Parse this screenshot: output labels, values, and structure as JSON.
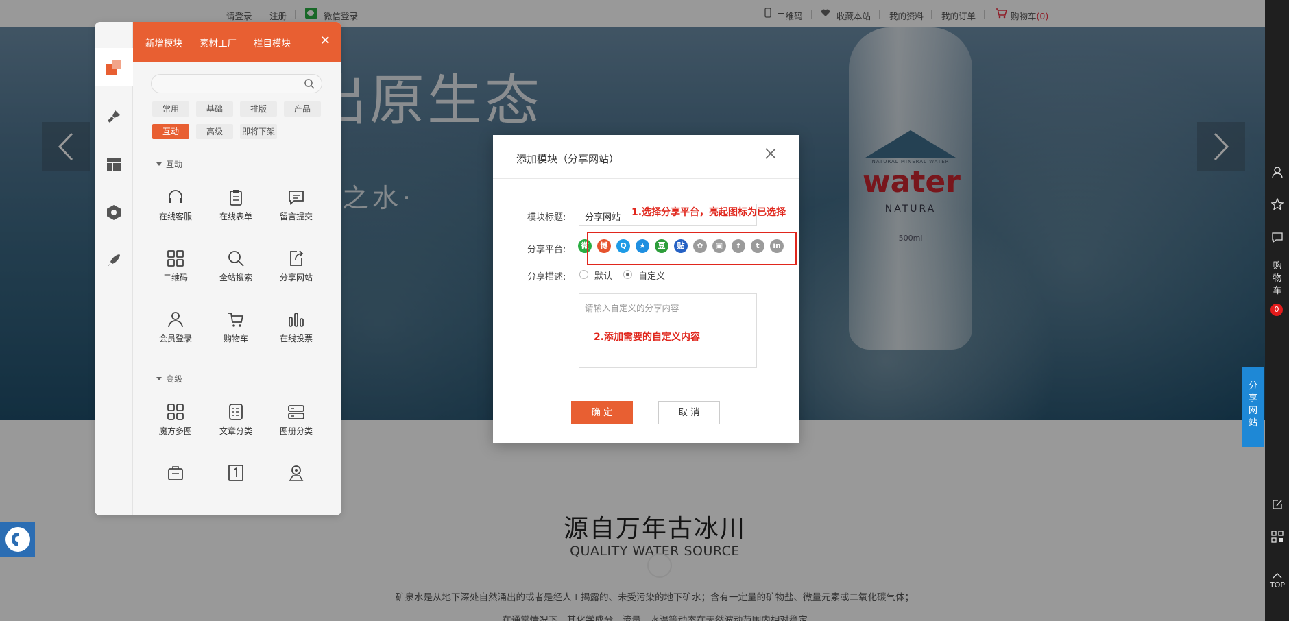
{
  "topbar": {
    "login": "请登录",
    "register": "注册",
    "wechat_login": "微信登录",
    "qrcode": "二维码",
    "favorite": "收藏本站",
    "my_profile": "我的资料",
    "my_orders": "我的订单",
    "cart_label": "购物车",
    "cart_count": "(0)"
  },
  "hero": {
    "title": "出原生态",
    "subtitle": "净之水·",
    "bottle_brand": "water",
    "bottle_small": "NATURAL MINERAL WATER",
    "bottle_natura": "NATURA",
    "bottle_volume": "500ml",
    "prev_icon": "chevron-left-icon",
    "next_icon": "chevron-right-icon"
  },
  "section": {
    "title": "源自万年古冰川",
    "title_en": "QUALITY WATER SOURCE",
    "body": "矿泉水是从地下深处自然涌出的或者是经人工揭露的、未受污染的地下矿水；含有一定量的矿物盐、微量元素或二氧化碳气体；",
    "body2": "在通常情况下，其化学成分、流量、水温等动态在天然波动范围内相对稳定"
  },
  "right_bar": {
    "cart_chars": [
      "购",
      "物",
      "车"
    ],
    "cart_badge": "0",
    "top_label": "TOP"
  },
  "share_tab": {
    "chars": [
      "分",
      "享",
      "网",
      "站"
    ]
  },
  "panel": {
    "tabs": [
      "新增模块",
      "素材工厂",
      "栏目模块"
    ],
    "search_placeholder": "",
    "filters": [
      "常用",
      "基础",
      "排版",
      "产品",
      "互动",
      "高级",
      "即将下架"
    ],
    "active_filter": "互动",
    "group_interact": "互动",
    "group_advanced": "高级",
    "interact_modules": [
      "在线客服",
      "在线表单",
      "留言提交",
      "二维码",
      "全站搜索",
      "分享网站",
      "会员登录",
      "购物车",
      "在线投票"
    ],
    "advanced_modules": [
      "魔方多图",
      "文章分类",
      "图册分类"
    ]
  },
  "modal": {
    "title": "添加模块（分享网站）",
    "label_title": "模块标题:",
    "title_value": "分享网站",
    "label_platform": "分享平台:",
    "label_desc": "分享描述:",
    "radio_default": "默认",
    "radio_custom": "自定义",
    "textarea_placeholder": "请输入自定义的分享内容",
    "annotation_1": "1.选择分享平台，亮起图标为已选择",
    "annotation_2": "2.添加需要的自定义内容",
    "ok_label": "确 定",
    "cancel_label": "取 消",
    "platforms": [
      {
        "name": "wechat",
        "glyph": "微",
        "color": "#2aae43"
      },
      {
        "name": "weibo",
        "glyph": "博",
        "color": "#e6532e"
      },
      {
        "name": "qq",
        "glyph": "Q",
        "color": "#1e9be6"
      },
      {
        "name": "qzone",
        "glyph": "★",
        "color": "#1f8fe0"
      },
      {
        "name": "douban",
        "glyph": "豆",
        "color": "#2d9d3a"
      },
      {
        "name": "tieba",
        "glyph": "贴",
        "color": "#2561c4"
      },
      {
        "name": "renren",
        "glyph": "✿",
        "color": "#9b9b9b"
      },
      {
        "name": "copy",
        "glyph": "▣",
        "color": "#9b9b9b"
      },
      {
        "name": "facebook",
        "glyph": "f",
        "color": "#9b9b9b"
      },
      {
        "name": "tumblr",
        "glyph": "t",
        "color": "#9b9b9b"
      },
      {
        "name": "linkedin",
        "glyph": "in",
        "color": "#9b9b9b"
      }
    ]
  }
}
